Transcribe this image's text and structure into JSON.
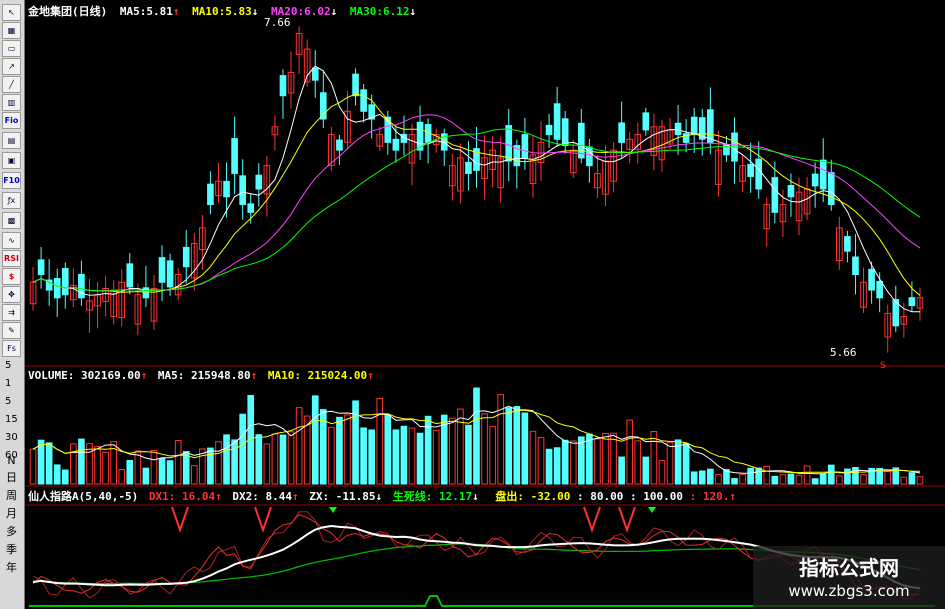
{
  "toolbar": {
    "icons": [
      {
        "name": "cursor-icon",
        "glyph": "↖"
      },
      {
        "name": "zoom-in-icon",
        "glyph": "▦"
      },
      {
        "name": "crosshair-icon",
        "glyph": "▭"
      },
      {
        "name": "chart-icon",
        "glyph": "↗"
      },
      {
        "name": "line-icon",
        "glyph": "╱"
      },
      {
        "name": "bar-chart-icon",
        "glyph": "▥"
      },
      {
        "name": "fio-icon",
        "glyph": "Fio"
      },
      {
        "name": "news-icon",
        "glyph": "▤"
      },
      {
        "name": "text-icon",
        "glyph": "▣"
      },
      {
        "name": "f10-icon",
        "glyph": "F10"
      },
      {
        "name": "formula-icon",
        "glyph": "ƒx"
      },
      {
        "name": "screen-icon",
        "glyph": "▩"
      },
      {
        "name": "indicator-icon",
        "glyph": "∿"
      },
      {
        "name": "rsi-icon",
        "glyph": "RSI"
      },
      {
        "name": "dollar-icon",
        "glyph": "$"
      },
      {
        "name": "move-icon",
        "glyph": "✥"
      },
      {
        "name": "export-icon",
        "glyph": "⇉"
      },
      {
        "name": "pencil-icon",
        "glyph": "✎"
      },
      {
        "name": "fs-icon",
        "glyph": "Fs"
      }
    ],
    "axis_numbers": [
      "5",
      "1",
      "5",
      "15",
      "30",
      "60"
    ],
    "period_tabs": [
      "N",
      "日",
      "周",
      "月",
      "多",
      "季",
      "年"
    ]
  },
  "main_header": {
    "stock": "金地集团(日线)",
    "ma5_label": "MA5:",
    "ma5_value": "5.81",
    "ma10_label": "MA10:",
    "ma10_value": "5.83",
    "ma20_label": "MA20:",
    "ma20_value": "6.02",
    "ma30_label": "MA30:",
    "ma30_value": "6.12",
    "high_label": "7.66",
    "low_label": "5.66"
  },
  "volume_header": {
    "volume_label": "VOLUME:",
    "volume_value": "302169.00",
    "ma5_label": "MA5:",
    "ma5_value": "215948.80",
    "ma10_label": "MA10:",
    "ma10_value": "215024.00"
  },
  "indicator_header": {
    "name": "仙人指路A(5,40,-5)",
    "dx1_label": "DX1:",
    "dx1_value": "16.04",
    "dx2_label": "DX2:",
    "dx2_value": "8.44",
    "zx_label": "ZX:",
    "zx_value": "-11.85",
    "life_label": "生死线:",
    "life_value": "12.17",
    "panchu_label": "盘出:",
    "panchu_value": "-32.00",
    "level1": ": 80.00",
    "level2": ": 100.00",
    "level3": ": 120."
  },
  "watermark": {
    "title": "指标公式网",
    "url": "www.zbgs3.com"
  },
  "colors": {
    "up": "#ff3232",
    "down": "#54ffff",
    "ma5": "#ffffff",
    "ma10": "#ffff00",
    "ma20": "#ff40ff",
    "ma30": "#00ff00",
    "panel_border": "#a00000"
  },
  "chart_data": {
    "type": "candlestick",
    "price_range": [
      5.5,
      7.7
    ],
    "close_series": [
      6.0,
      6.05,
      5.95,
      5.9,
      5.92,
      5.98,
      5.9,
      5.88,
      5.92,
      5.96,
      5.95,
      6.0,
      5.97,
      5.92,
      5.9,
      5.96,
      6.0,
      5.97,
      6.05,
      6.1,
      6.25,
      6.35,
      6.5,
      6.65,
      6.55,
      6.7,
      6.5,
      6.45,
      6.6,
      6.75,
      7.0,
      7.2,
      7.35,
      7.6,
      7.5,
      7.3,
      7.05,
      6.95,
      6.85,
      7.1,
      7.2,
      7.1,
      7.05,
      6.95,
      6.9,
      6.85,
      6.9,
      6.95,
      6.85,
      6.9,
      6.95,
      6.85,
      6.75,
      6.8,
      6.7,
      6.72,
      6.8,
      6.85,
      6.8,
      6.78,
      6.75,
      6.8,
      6.82,
      6.9,
      6.95,
      6.92,
      6.88,
      6.85,
      6.8,
      6.75,
      6.7,
      6.78,
      6.85,
      6.9,
      6.92,
      6.95,
      6.98,
      7.0,
      7.0,
      6.98,
      6.95,
      6.9,
      6.95,
      6.92,
      6.9,
      6.85,
      6.82,
      6.78,
      6.75,
      6.68,
      6.6,
      6.5,
      6.45,
      6.5,
      6.55,
      6.58,
      6.6,
      6.62,
      6.6,
      6.5,
      6.35,
      6.2,
      6.05,
      6.0,
      5.95,
      5.9,
      5.8,
      5.72,
      5.78,
      5.85,
      5.9
    ],
    "volume_max": 60
  }
}
